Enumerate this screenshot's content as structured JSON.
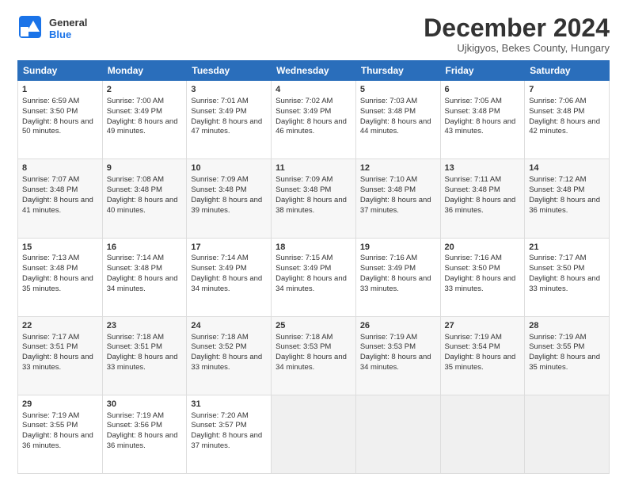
{
  "logo": {
    "line1": "General",
    "line2": "Blue"
  },
  "header": {
    "title": "December 2024",
    "subtitle": "Ujkigyos, Bekes County, Hungary"
  },
  "weekdays": [
    "Sunday",
    "Monday",
    "Tuesday",
    "Wednesday",
    "Thursday",
    "Friday",
    "Saturday"
  ],
  "weeks": [
    [
      {
        "day": "1",
        "sunrise": "Sunrise: 6:59 AM",
        "sunset": "Sunset: 3:50 PM",
        "daylight": "Daylight: 8 hours and 50 minutes."
      },
      {
        "day": "2",
        "sunrise": "Sunrise: 7:00 AM",
        "sunset": "Sunset: 3:49 PM",
        "daylight": "Daylight: 8 hours and 49 minutes."
      },
      {
        "day": "3",
        "sunrise": "Sunrise: 7:01 AM",
        "sunset": "Sunset: 3:49 PM",
        "daylight": "Daylight: 8 hours and 47 minutes."
      },
      {
        "day": "4",
        "sunrise": "Sunrise: 7:02 AM",
        "sunset": "Sunset: 3:49 PM",
        "daylight": "Daylight: 8 hours and 46 minutes."
      },
      {
        "day": "5",
        "sunrise": "Sunrise: 7:03 AM",
        "sunset": "Sunset: 3:48 PM",
        "daylight": "Daylight: 8 hours and 44 minutes."
      },
      {
        "day": "6",
        "sunrise": "Sunrise: 7:05 AM",
        "sunset": "Sunset: 3:48 PM",
        "daylight": "Daylight: 8 hours and 43 minutes."
      },
      {
        "day": "7",
        "sunrise": "Sunrise: 7:06 AM",
        "sunset": "Sunset: 3:48 PM",
        "daylight": "Daylight: 8 hours and 42 minutes."
      }
    ],
    [
      {
        "day": "8",
        "sunrise": "Sunrise: 7:07 AM",
        "sunset": "Sunset: 3:48 PM",
        "daylight": "Daylight: 8 hours and 41 minutes."
      },
      {
        "day": "9",
        "sunrise": "Sunrise: 7:08 AM",
        "sunset": "Sunset: 3:48 PM",
        "daylight": "Daylight: 8 hours and 40 minutes."
      },
      {
        "day": "10",
        "sunrise": "Sunrise: 7:09 AM",
        "sunset": "Sunset: 3:48 PM",
        "daylight": "Daylight: 8 hours and 39 minutes."
      },
      {
        "day": "11",
        "sunrise": "Sunrise: 7:09 AM",
        "sunset": "Sunset: 3:48 PM",
        "daylight": "Daylight: 8 hours and 38 minutes."
      },
      {
        "day": "12",
        "sunrise": "Sunrise: 7:10 AM",
        "sunset": "Sunset: 3:48 PM",
        "daylight": "Daylight: 8 hours and 37 minutes."
      },
      {
        "day": "13",
        "sunrise": "Sunrise: 7:11 AM",
        "sunset": "Sunset: 3:48 PM",
        "daylight": "Daylight: 8 hours and 36 minutes."
      },
      {
        "day": "14",
        "sunrise": "Sunrise: 7:12 AM",
        "sunset": "Sunset: 3:48 PM",
        "daylight": "Daylight: 8 hours and 36 minutes."
      }
    ],
    [
      {
        "day": "15",
        "sunrise": "Sunrise: 7:13 AM",
        "sunset": "Sunset: 3:48 PM",
        "daylight": "Daylight: 8 hours and 35 minutes."
      },
      {
        "day": "16",
        "sunrise": "Sunrise: 7:14 AM",
        "sunset": "Sunset: 3:48 PM",
        "daylight": "Daylight: 8 hours and 34 minutes."
      },
      {
        "day": "17",
        "sunrise": "Sunrise: 7:14 AM",
        "sunset": "Sunset: 3:49 PM",
        "daylight": "Daylight: 8 hours and 34 minutes."
      },
      {
        "day": "18",
        "sunrise": "Sunrise: 7:15 AM",
        "sunset": "Sunset: 3:49 PM",
        "daylight": "Daylight: 8 hours and 34 minutes."
      },
      {
        "day": "19",
        "sunrise": "Sunrise: 7:16 AM",
        "sunset": "Sunset: 3:49 PM",
        "daylight": "Daylight: 8 hours and 33 minutes."
      },
      {
        "day": "20",
        "sunrise": "Sunrise: 7:16 AM",
        "sunset": "Sunset: 3:50 PM",
        "daylight": "Daylight: 8 hours and 33 minutes."
      },
      {
        "day": "21",
        "sunrise": "Sunrise: 7:17 AM",
        "sunset": "Sunset: 3:50 PM",
        "daylight": "Daylight: 8 hours and 33 minutes."
      }
    ],
    [
      {
        "day": "22",
        "sunrise": "Sunrise: 7:17 AM",
        "sunset": "Sunset: 3:51 PM",
        "daylight": "Daylight: 8 hours and 33 minutes."
      },
      {
        "day": "23",
        "sunrise": "Sunrise: 7:18 AM",
        "sunset": "Sunset: 3:51 PM",
        "daylight": "Daylight: 8 hours and 33 minutes."
      },
      {
        "day": "24",
        "sunrise": "Sunrise: 7:18 AM",
        "sunset": "Sunset: 3:52 PM",
        "daylight": "Daylight: 8 hours and 33 minutes."
      },
      {
        "day": "25",
        "sunrise": "Sunrise: 7:18 AM",
        "sunset": "Sunset: 3:53 PM",
        "daylight": "Daylight: 8 hours and 34 minutes."
      },
      {
        "day": "26",
        "sunrise": "Sunrise: 7:19 AM",
        "sunset": "Sunset: 3:53 PM",
        "daylight": "Daylight: 8 hours and 34 minutes."
      },
      {
        "day": "27",
        "sunrise": "Sunrise: 7:19 AM",
        "sunset": "Sunset: 3:54 PM",
        "daylight": "Daylight: 8 hours and 35 minutes."
      },
      {
        "day": "28",
        "sunrise": "Sunrise: 7:19 AM",
        "sunset": "Sunset: 3:55 PM",
        "daylight": "Daylight: 8 hours and 35 minutes."
      }
    ],
    [
      {
        "day": "29",
        "sunrise": "Sunrise: 7:19 AM",
        "sunset": "Sunset: 3:55 PM",
        "daylight": "Daylight: 8 hours and 36 minutes."
      },
      {
        "day": "30",
        "sunrise": "Sunrise: 7:19 AM",
        "sunset": "Sunset: 3:56 PM",
        "daylight": "Daylight: 8 hours and 36 minutes."
      },
      {
        "day": "31",
        "sunrise": "Sunrise: 7:20 AM",
        "sunset": "Sunset: 3:57 PM",
        "daylight": "Daylight: 8 hours and 37 minutes."
      },
      null,
      null,
      null,
      null
    ]
  ]
}
